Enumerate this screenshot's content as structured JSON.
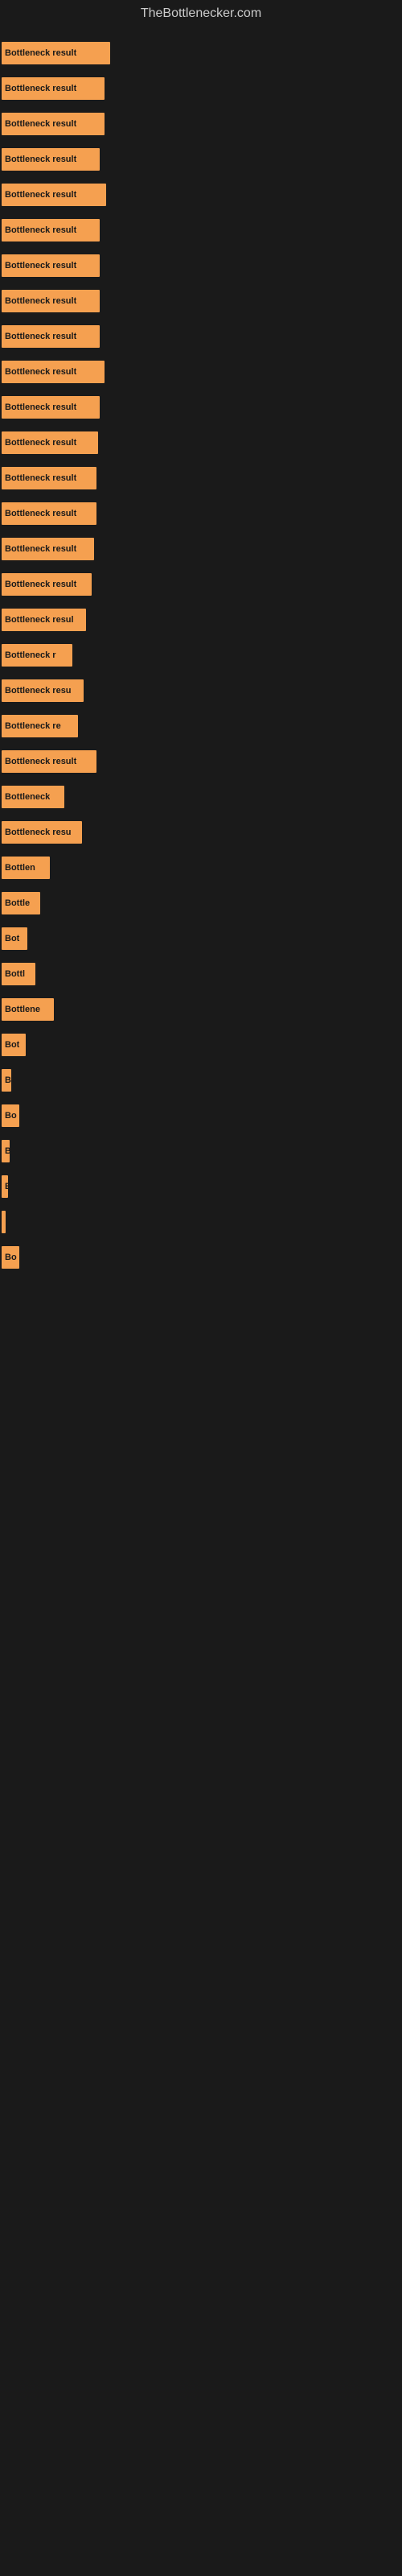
{
  "site_title": "TheBottlenecker.com",
  "bars": [
    {
      "label": "Bottleneck result",
      "width": 135
    },
    {
      "label": "Bottleneck result",
      "width": 128
    },
    {
      "label": "Bottleneck result",
      "width": 128
    },
    {
      "label": "Bottleneck result",
      "width": 122
    },
    {
      "label": "Bottleneck result",
      "width": 130
    },
    {
      "label": "Bottleneck result",
      "width": 122
    },
    {
      "label": "Bottleneck result",
      "width": 122
    },
    {
      "label": "Bottleneck result",
      "width": 122
    },
    {
      "label": "Bottleneck result",
      "width": 122
    },
    {
      "label": "Bottleneck result",
      "width": 128
    },
    {
      "label": "Bottleneck result",
      "width": 122
    },
    {
      "label": "Bottleneck result",
      "width": 120
    },
    {
      "label": "Bottleneck result",
      "width": 118
    },
    {
      "label": "Bottleneck result",
      "width": 118
    },
    {
      "label": "Bottleneck result",
      "width": 115
    },
    {
      "label": "Bottleneck result",
      "width": 112
    },
    {
      "label": "Bottleneck resul",
      "width": 105
    },
    {
      "label": "Bottleneck r",
      "width": 88
    },
    {
      "label": "Bottleneck resu",
      "width": 102
    },
    {
      "label": "Bottleneck re",
      "width": 95
    },
    {
      "label": "Bottleneck result",
      "width": 118
    },
    {
      "label": "Bottleneck",
      "width": 78
    },
    {
      "label": "Bottleneck resu",
      "width": 100
    },
    {
      "label": "Bottlen",
      "width": 60
    },
    {
      "label": "Bottle",
      "width": 48
    },
    {
      "label": "Bot",
      "width": 32
    },
    {
      "label": "Bottl",
      "width": 42
    },
    {
      "label": "Bottlene",
      "width": 65
    },
    {
      "label": "Bot",
      "width": 30
    },
    {
      "label": "B",
      "width": 12
    },
    {
      "label": "Bo",
      "width": 22
    },
    {
      "label": "B",
      "width": 10
    },
    {
      "label": "B",
      "width": 8
    },
    {
      "label": "",
      "width": 5
    },
    {
      "label": "Bo",
      "width": 22
    }
  ]
}
